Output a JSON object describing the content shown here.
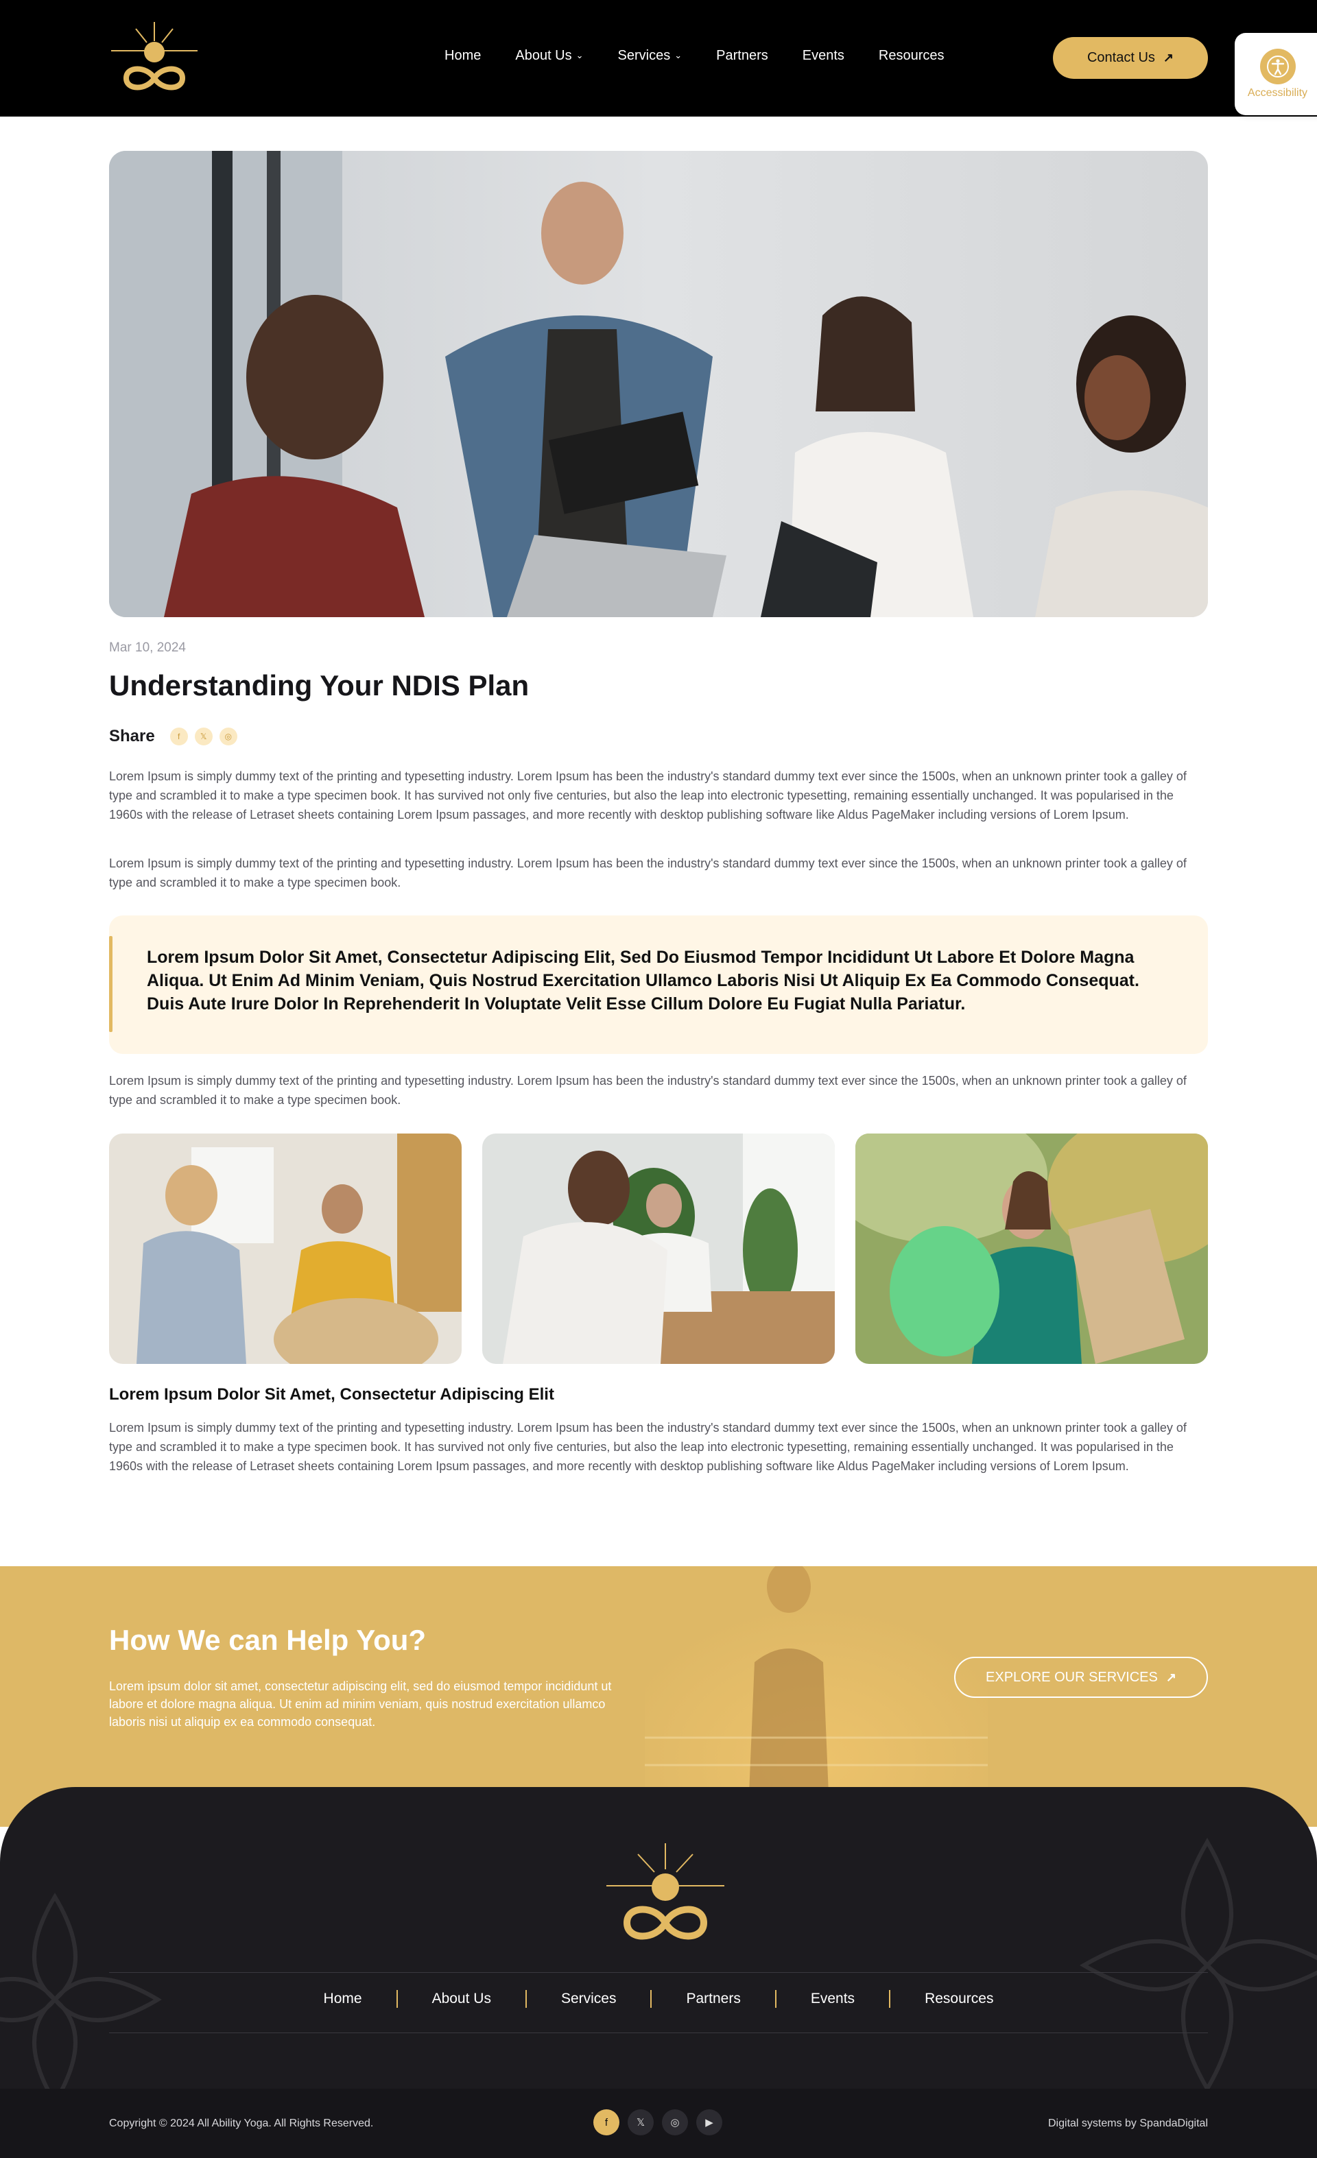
{
  "header": {
    "nav": [
      {
        "label": "Home",
        "has_dropdown": false
      },
      {
        "label": "About Us",
        "has_dropdown": true
      },
      {
        "label": "Services",
        "has_dropdown": true
      },
      {
        "label": "Partners",
        "has_dropdown": false
      },
      {
        "label": "Events",
        "has_dropdown": false
      },
      {
        "label": "Resources",
        "has_dropdown": false
      }
    ],
    "contact_label": "Contact Us",
    "accessibility_label": "Accessibility"
  },
  "article": {
    "date": "Mar 10, 2024",
    "title": "Understanding Your NDIS Plan",
    "share_label": "Share",
    "share_icons": [
      "facebook-icon",
      "x-icon",
      "instagram-icon"
    ],
    "paragraph_1": "Lorem Ipsum is simply dummy text of the printing and typesetting industry. Lorem Ipsum has been the industry's standard dummy text ever since the 1500s, when an unknown printer took a galley of type and scrambled it to make a type specimen book. It has survived not only five centuries, but also the leap into electronic typesetting, remaining essentially unchanged. It was popularised in the 1960s with the release of Letraset sheets containing Lorem Ipsum passages, and more recently with desktop publishing software like Aldus PageMaker including versions of Lorem Ipsum.",
    "paragraph_2": "Lorem Ipsum is simply dummy text of the printing and typesetting industry. Lorem Ipsum has been the industry's standard dummy text ever since the 1500s, when an unknown printer took a galley of type and scrambled it to make a type specimen book.",
    "quote": "Lorem Ipsum Dolor Sit Amet, Consectetur Adipiscing Elit, Sed Do Eiusmod Tempor Incididunt Ut Labore Et Dolore Magna Aliqua. Ut Enim Ad Minim Veniam, Quis Nostrud Exercitation Ullamco Laboris Nisi Ut Aliquip Ex Ea Commodo Consequat. Duis Aute Irure Dolor In Reprehenderit In Voluptate Velit Esse Cillum Dolore Eu Fugiat Nulla Pariatur.",
    "paragraph_3": "Lorem Ipsum is simply dummy text of the printing and typesetting industry. Lorem Ipsum has been the industry's standard dummy text ever since the 1500s, when an unknown printer took a galley of type and scrambled it to make a type specimen book.",
    "subheading": "Lorem Ipsum Dolor Sit Amet, Consectetur Adipiscing Elit",
    "paragraph_4": "Lorem Ipsum is simply dummy text of the printing and typesetting industry. Lorem Ipsum has been the industry's standard dummy text ever since the 1500s, when an unknown printer took a galley of type and scrambled it to make a type specimen book. It has survived not only five centuries, but also the leap into electronic typesetting, remaining essentially unchanged. It was popularised in the 1960s with the release of Letraset sheets containing Lorem Ipsum passages, and more recently with desktop publishing software like Aldus PageMaker including versions of Lorem Ipsum."
  },
  "cta": {
    "title": "How We can Help You?",
    "text": "Lorem ipsum dolor sit amet, consectetur adipiscing elit, sed do eiusmod tempor incididunt ut labore et dolore magna aliqua. Ut enim ad minim veniam, quis nostrud exercitation ullamco laboris nisi ut aliquip ex ea commodo consequat.",
    "button_label": "EXPLORE OUR SERVICES"
  },
  "footer": {
    "nav": [
      "Home",
      "About Us",
      "Services",
      "Partners",
      "Events",
      "Resources"
    ],
    "copyright": "Copyright © 2024 All Ability Yoga. All Rights Reserved.",
    "social": [
      "facebook-icon",
      "x-icon",
      "instagram-icon",
      "youtube-icon"
    ],
    "credit": "Digital systems by SpandaDigital"
  },
  "colors": {
    "accent": "#e2b962",
    "header_bg": "#000000",
    "footer_bg": "#1c1b1f",
    "quote_bg": "#fff6e6"
  }
}
